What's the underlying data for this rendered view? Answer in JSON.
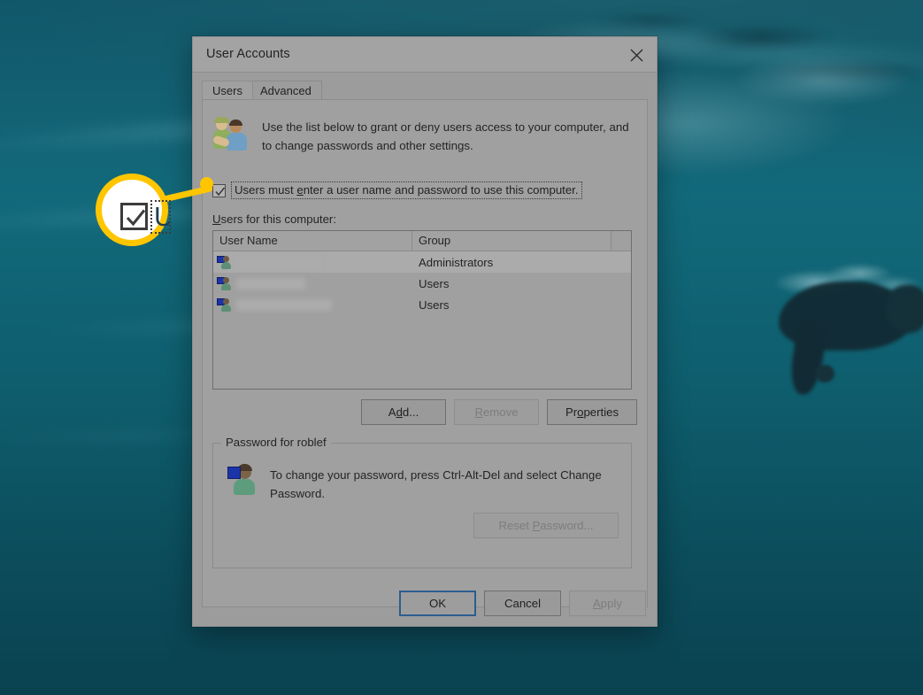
{
  "desktop": {
    "wallpaper_description": "underwater-swimmer-teal"
  },
  "dialog": {
    "title": "User Accounts",
    "close_icon": "close-icon",
    "tabs": [
      {
        "label": "Users",
        "active": true
      },
      {
        "label": "Advanced",
        "active": false
      }
    ],
    "users_tab": {
      "header_icon": "two-users-icon",
      "header_text": "Use the list below to grant or deny users access to your computer, and to change passwords and other settings.",
      "checkbox": {
        "checked": true,
        "label_prefix": "Users must ",
        "label_accesskey": "e",
        "label_suffix": "nter a user name and password to use this computer.",
        "label_full": "Users must enter a user name and password to use this computer.",
        "focused": true
      },
      "list_label_prefix": "U",
      "list_label_suffix": "sers for this computer:",
      "list_label_full": "Users for this computer:",
      "list": {
        "columns": [
          "User Name",
          "Group"
        ],
        "rows": [
          {
            "user_name": "",
            "redacted": true,
            "redact_width": 96,
            "group": "Administrators",
            "selected": true
          },
          {
            "user_name": "",
            "redacted": true,
            "redact_width": 78,
            "group": "Users",
            "selected": false
          },
          {
            "user_name": "",
            "redacted": true,
            "redact_width": 108,
            "group": "Users",
            "selected": false
          }
        ]
      },
      "buttons": {
        "add": {
          "prefix": "A",
          "accesskey": "d",
          "suffix": "d...",
          "label": "Add...",
          "disabled": false
        },
        "remove": {
          "accesskey": "R",
          "suffix": "emove",
          "label": "Remove",
          "disabled": true
        },
        "properties": {
          "prefix": "Pr",
          "accesskey": "o",
          "suffix": "perties",
          "label": "Properties",
          "disabled": false
        }
      },
      "password_group": {
        "legend": "Password for roblef",
        "icon": "single-user-icon",
        "text": "To change your password, press Ctrl-Alt-Del and select Change Password.",
        "reset_button": {
          "prefix": "Reset ",
          "accesskey": "P",
          "suffix": "assword...",
          "label": "Reset Password...",
          "disabled": true
        }
      }
    },
    "footer_buttons": {
      "ok": {
        "label": "OK",
        "default": true,
        "disabled": false
      },
      "cancel": {
        "label": "Cancel",
        "disabled": false
      },
      "apply": {
        "prefix": "",
        "accesskey": "A",
        "suffix": "pply",
        "label": "Apply",
        "disabled": true
      }
    }
  },
  "callout": {
    "type": "magnifier-circle",
    "ring_color": "#ffc600",
    "fill_color": "#ffffff",
    "points_to": "checkbox-users-must-enter",
    "magnified_checkbox_checked": true,
    "magnified_letter": "U"
  }
}
